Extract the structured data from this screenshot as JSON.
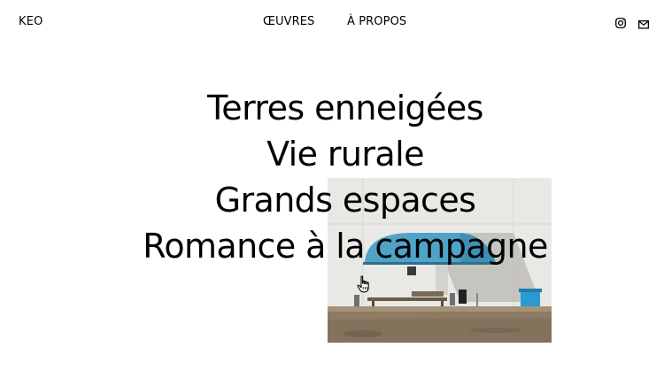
{
  "header": {
    "brand": "KEO",
    "nav": [
      {
        "label": "ŒUVRES"
      },
      {
        "label": "À PROPOS"
      }
    ],
    "icons": [
      "instagram-icon",
      "mail-icon"
    ]
  },
  "main": {
    "titles": [
      "Terres enneigées",
      "Vie rurale",
      "Grands espaces",
      "Romance à la campagne"
    ]
  },
  "colors": {
    "text": "#000000",
    "background": "#ffffff",
    "awning_blue": "#4fa3c7",
    "bin_blue": "#2a9bd1",
    "wall": "#e8e6e1",
    "ground": "#8c7a63"
  }
}
